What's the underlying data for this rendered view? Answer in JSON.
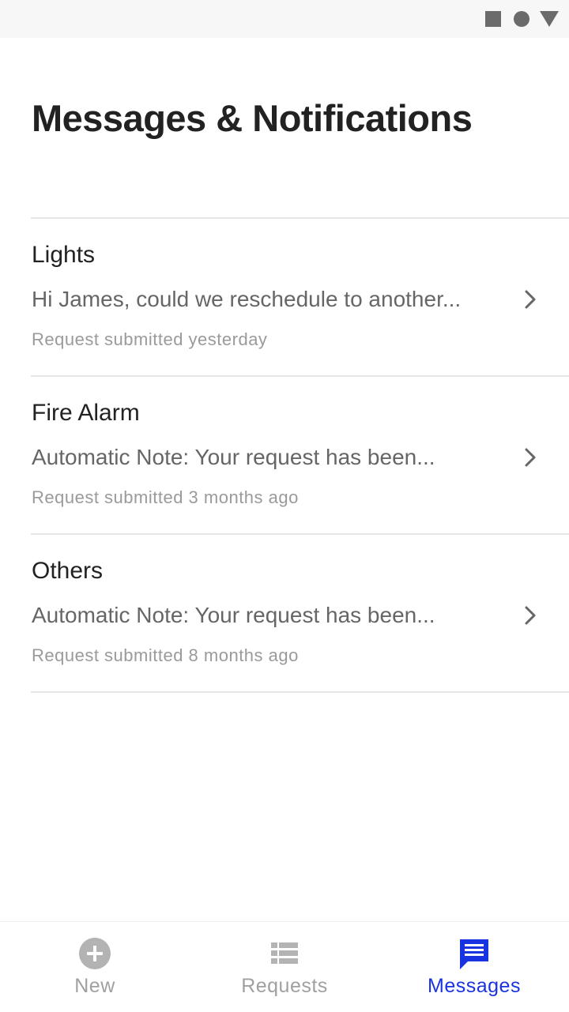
{
  "status_bar": {
    "icons": [
      "square-icon",
      "circle-icon",
      "triangle-icon"
    ]
  },
  "header": {
    "title": "Messages & Notifications"
  },
  "messages": [
    {
      "title": "Lights",
      "preview": "Hi James, could we reschedule to another...",
      "meta": "Request submitted yesterday"
    },
    {
      "title": "Fire Alarm",
      "preview": "Automatic Note: Your request has been...",
      "meta": "Request submitted 3 months ago"
    },
    {
      "title": "Others",
      "preview": "Automatic Note: Your request has been...",
      "meta": "Request submitted 8 months ago"
    }
  ],
  "bottom_nav": {
    "items": [
      {
        "label": "New",
        "icon": "plus-circle-icon",
        "active": false
      },
      {
        "label": "Requests",
        "icon": "list-icon",
        "active": false
      },
      {
        "label": "Messages",
        "icon": "chat-icon",
        "active": true
      }
    ]
  },
  "colors": {
    "accent": "#1a33e0",
    "title_text": "#222222",
    "preview_text": "#666666",
    "meta_text": "#9a9a9a",
    "inactive_nav": "#a0a0a0",
    "divider": "#e6e6e6",
    "status_bar_bg": "#f7f7f7"
  }
}
